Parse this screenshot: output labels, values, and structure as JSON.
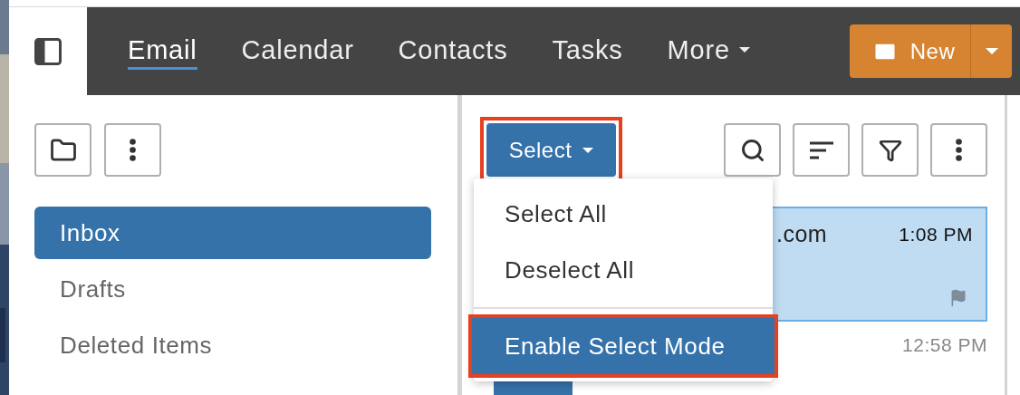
{
  "nav": {
    "tabs": [
      {
        "label": "Email",
        "selected": true
      },
      {
        "label": "Calendar",
        "selected": false
      },
      {
        "label": "Contacts",
        "selected": false
      },
      {
        "label": "Tasks",
        "selected": false
      },
      {
        "label": "More",
        "selected": false,
        "dropdown": true
      }
    ],
    "new_button": {
      "label": "New"
    }
  },
  "sidebar": {
    "folders": [
      {
        "label": "Inbox",
        "selected": true
      },
      {
        "label": "Drafts",
        "selected": false
      },
      {
        "label": "Deleted Items",
        "selected": false
      }
    ]
  },
  "toolbar": {
    "select_button": {
      "label": "Select",
      "highlighted": true
    }
  },
  "select_menu": {
    "items": [
      {
        "label": "Select All",
        "selected": false,
        "highlighted": false
      },
      {
        "label": "Deselect All",
        "selected": false,
        "highlighted": false,
        "separator_after": true
      },
      {
        "label": "Enable Select Mode",
        "selected": true,
        "highlighted": true
      }
    ]
  },
  "messages": [
    {
      "sender": ".com",
      "time": "1:08 PM",
      "selected": true,
      "flagged": true,
      "unread": true
    },
    {
      "time": "12:58 PM",
      "kind": "with-avatar",
      "unread": false
    }
  ]
}
